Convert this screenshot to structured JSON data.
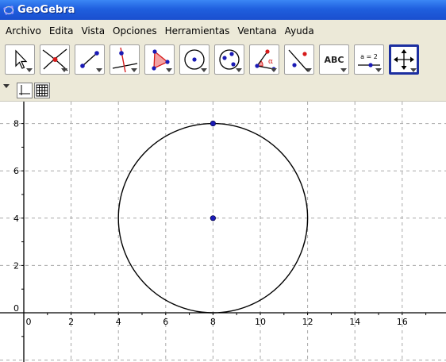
{
  "window": {
    "title": "GeoGebra"
  },
  "menu": [
    {
      "label": "Archivo"
    },
    {
      "label": "Edita"
    },
    {
      "label": "Vista"
    },
    {
      "label": "Opciones"
    },
    {
      "label": "Herramientas"
    },
    {
      "label": "Ventana"
    },
    {
      "label": "Ayuda"
    }
  ],
  "toolbar": {
    "tools": [
      {
        "name": "move-tool-icon"
      },
      {
        "name": "intersect-point-tool-icon"
      },
      {
        "name": "segment-tool-icon"
      },
      {
        "name": "perpendicular-line-tool-icon"
      },
      {
        "name": "polygon-tool-icon"
      },
      {
        "name": "circle-center-point-tool-icon"
      },
      {
        "name": "circle-three-points-tool-icon"
      },
      {
        "name": "angle-tool-icon"
      },
      {
        "name": "reflect-tool-icon"
      },
      {
        "name": "text-tool-icon",
        "label": "ABC"
      },
      {
        "name": "slider-tool-icon",
        "label": "a = 2"
      },
      {
        "name": "move-graphics-view-tool-icon",
        "selected": true
      }
    ]
  },
  "stylebar": {
    "buttons": [
      {
        "name": "show-axes-icon"
      },
      {
        "name": "show-grid-icon"
      }
    ]
  },
  "graphics": {
    "x_axis": {
      "min": -1,
      "max": 17.4,
      "ticks": [
        0,
        2,
        4,
        6,
        8,
        10,
        12,
        14,
        16
      ]
    },
    "y_axis": {
      "min": -2,
      "max": 8.4,
      "ticks": [
        0,
        2,
        4,
        6,
        8
      ]
    },
    "grid": true,
    "circle": {
      "center": [
        8,
        4
      ],
      "radius": 4
    },
    "points": [
      {
        "name": "center-point",
        "x": 8,
        "y": 4
      },
      {
        "name": "circle-point",
        "x": 8,
        "y": 8
      }
    ],
    "colors": {
      "point": "#1a1ab5",
      "grid": "#a8a8a8",
      "axis": "#000000",
      "circle": "#000000"
    }
  }
}
